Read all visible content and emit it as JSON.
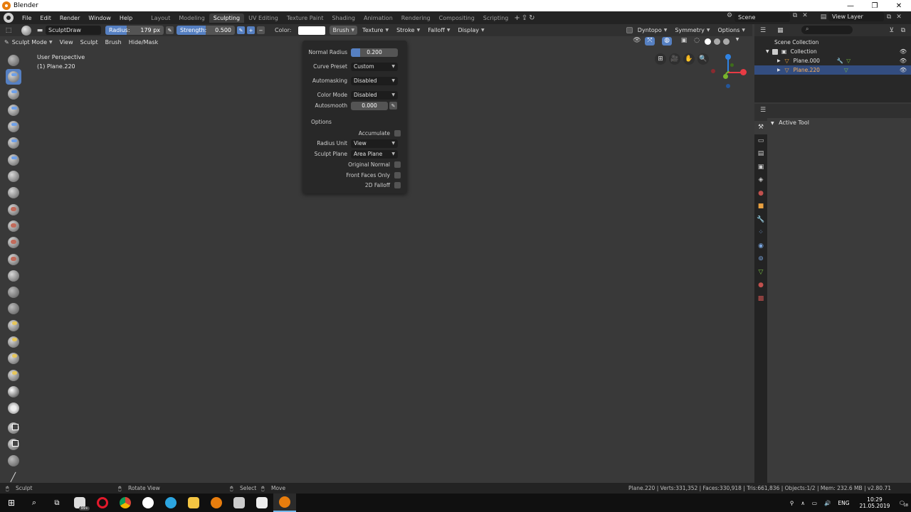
{
  "window": {
    "title": "Blender",
    "controls": [
      "—",
      "❐",
      "✕"
    ]
  },
  "menu": [
    "File",
    "Edit",
    "Render",
    "Window",
    "Help"
  ],
  "workspaces": [
    {
      "label": "Layout",
      "active": false
    },
    {
      "label": "Modeling",
      "active": false
    },
    {
      "label": "Sculpting",
      "active": true
    },
    {
      "label": "UV Editing",
      "active": false
    },
    {
      "label": "Texture Paint",
      "active": false
    },
    {
      "label": "Shading",
      "active": false
    },
    {
      "label": "Animation",
      "active": false
    },
    {
      "label": "Rendering",
      "active": false
    },
    {
      "label": "Compositing",
      "active": false
    },
    {
      "label": "Scripting",
      "active": false
    }
  ],
  "scene": {
    "name": "Scene",
    "view_layer": "View Layer"
  },
  "tool_header": {
    "brush_name": "SculptDraw",
    "radius_label": "Radius:",
    "radius_value": "179 px",
    "strength_label": "Strength:",
    "strength_value": "0.500",
    "strength_fraction": 0.5,
    "color_label": "Color:",
    "color_value": "#ffffff",
    "dropdowns": [
      "Brush",
      "Texture",
      "Stroke",
      "Falloff",
      "Display"
    ],
    "right": {
      "dyntopo": "Dyntopo",
      "symmetry": "Symmetry",
      "options": "Options"
    }
  },
  "mode_header": {
    "mode": "Sculpt Mode",
    "items": [
      "View",
      "Sculpt",
      "Brush",
      "Hide/Mask"
    ]
  },
  "viewport": {
    "perspective": "User Perspective",
    "object": "(1) Plane.220"
  },
  "brush_popover": {
    "normal_radius_label": "Normal Radius",
    "normal_radius_value": "0.200",
    "normal_radius_fraction": 0.2,
    "curve_preset_label": "Curve Preset",
    "curve_preset_value": "Custom",
    "automasking_label": "Automasking",
    "automasking_value": "Disabled",
    "color_mode_label": "Color Mode",
    "color_mode_value": "Disabled",
    "autosmooth_label": "Autosmooth",
    "autosmooth_value": "0.000",
    "options_heading": "Options",
    "accumulate_label": "Accumulate",
    "radius_unit_label": "Radius Unit",
    "radius_unit_value": "View",
    "sculpt_plane_label": "Sculpt Plane",
    "sculpt_plane_value": "Area Plane",
    "original_normal_label": "Original Normal",
    "front_faces_label": "Front Faces Only",
    "falloff_2d_label": "2D Falloff"
  },
  "outliner": {
    "scene_collection": "Scene Collection",
    "collection": "Collection",
    "objects": [
      {
        "name": "Plane.000",
        "selected": false
      },
      {
        "name": "Plane.220",
        "selected": true
      }
    ]
  },
  "properties": {
    "panel_title": "Active Tool"
  },
  "status_bar": {
    "left": "Sculpt",
    "rotate": "Rotate View",
    "select": "Select",
    "move": "Move",
    "stats": "Plane.220 | Verts:331,352 | Faces:330,918 | Tris:661,836 | Objects:1/2 | Mem: 232.6 MB | v2.80.71"
  },
  "taskbar": {
    "badge": "99+",
    "lang": "ENG",
    "time": "10:29",
    "date": "21.05.2019",
    "notifications": "18"
  },
  "colors": {
    "accent": "#5680c2",
    "selection": "#334d80",
    "orange": "#e87d0d"
  }
}
